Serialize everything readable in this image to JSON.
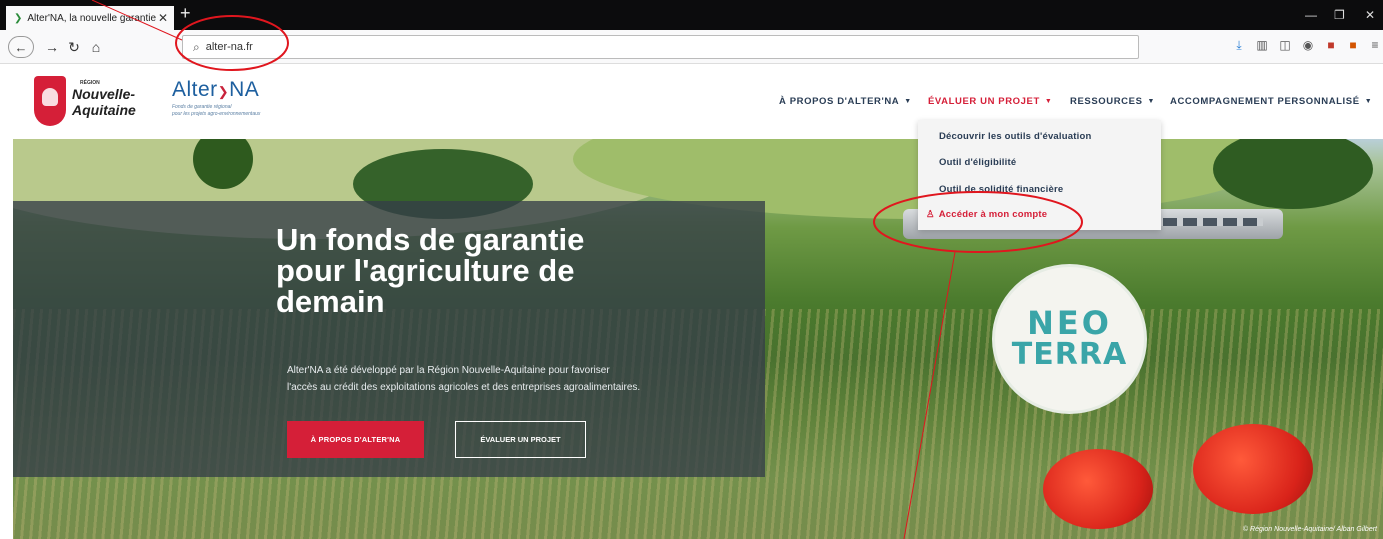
{
  "browser": {
    "tab_title": "Alter'NA, la nouvelle garantie",
    "tab_close": "✕",
    "new_tab": "+",
    "url": "alter-na.fr",
    "window_controls": [
      "—",
      "❐",
      "✕"
    ]
  },
  "site": {
    "region_label": "RÉGION",
    "region_name_1": "Nouvelle-",
    "region_name_2": "Aquitaine",
    "brand_name": "Alter",
    "brand_name_2": "NA",
    "brand_tagline_1": "Fonds de garantie régional",
    "brand_tagline_2": "pour les projets agro-environnementaux",
    "menu": [
      {
        "label": "À PROPOS D'ALTER'NA",
        "active": false
      },
      {
        "label": "ÉVALUER UN PROJET",
        "active": true
      },
      {
        "label": "RESSOURCES",
        "active": false
      },
      {
        "label": "ACCOMPAGNEMENT PERSONNALISÉ",
        "active": false
      }
    ],
    "dropdown": [
      "Découvrir les outils d'évaluation",
      "Outil d'éligibilité",
      "Outil de solidité financière",
      "Accéder à mon compte"
    ]
  },
  "hero": {
    "title_lines": [
      "Un fonds de garantie",
      "pour l'agriculture de",
      "demain"
    ],
    "description_lines": [
      "Alter'NA a été développé par la Région Nouvelle-Aquitaine pour favoriser",
      "l'accès au crédit des exploitations agricoles et des entreprises agroalimentaires."
    ],
    "btn_primary": "À PROPOS D'ALTER'NA",
    "btn_secondary": "ÉVALUER UN PROJET",
    "neo_line1": "NEO",
    "neo_line2": "TERRA",
    "credit": "© Région Nouvelle-Aquitaine/ Alban Gilbert"
  },
  "colors": {
    "accent": "#d51f38",
    "nav_text": "#2a3d55",
    "brand_blue": "#1d5f9f",
    "annotation_red": "#e0161e"
  },
  "icons": {
    "back": "back-arrow-icon",
    "forward": "forward-arrow-icon",
    "reload": "reload-icon",
    "home": "home-icon",
    "search": "search-icon",
    "user": "user-icon"
  }
}
